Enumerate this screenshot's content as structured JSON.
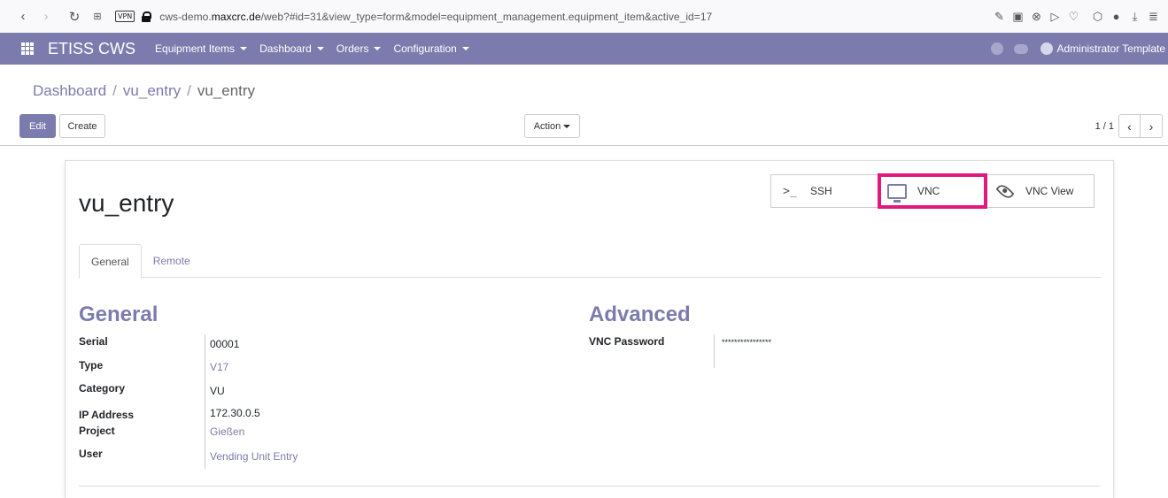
{
  "browser": {
    "vpn_badge": "VPN",
    "url_prefix": "cws-demo.",
    "url_domain": "maxcrc.de",
    "url_rest": "/web?#id=31&view_type=form&model=equipment_management.equipment_item&active_id=17"
  },
  "nav": {
    "brand": "ETISS CWS",
    "menu": [
      {
        "label": "Equipment Items"
      },
      {
        "label": "Dashboard"
      },
      {
        "label": "Orders"
      },
      {
        "label": "Configuration"
      }
    ],
    "user": "Administrator Template"
  },
  "breadcrumb": {
    "items": [
      "Dashboard",
      "vu_entry",
      "vu_entry"
    ],
    "separator": "/"
  },
  "control": {
    "edit_label": "Edit",
    "create_label": "Create",
    "action_label": "Action",
    "pager": "1 / 1"
  },
  "form": {
    "title": "vu_entry",
    "buttons": [
      {
        "label": "SSH",
        "icon": "terminal-icon"
      },
      {
        "label": "VNC",
        "icon": "monitor-icon"
      },
      {
        "label": "VNC View",
        "icon": "eye-icon"
      }
    ],
    "tabs": [
      {
        "label": "General",
        "active": true
      },
      {
        "label": "Remote",
        "active": false
      }
    ],
    "general": {
      "title": "General",
      "fields": {
        "serial": {
          "label": "Serial",
          "value": "00001"
        },
        "type": {
          "label": "Type",
          "value": "V17"
        },
        "category": {
          "label": "Category",
          "value": "VU"
        },
        "ip": {
          "label": "IP Address",
          "value": "172.30.0.5"
        },
        "project": {
          "label": "Project",
          "value": "Gießen"
        },
        "user": {
          "label": "User",
          "value": "Vending Unit Entry"
        }
      }
    },
    "advanced": {
      "title": "Advanced",
      "vnc_password": {
        "label": "VNC Password",
        "value": "****************"
      }
    }
  },
  "colors": {
    "brand": "#7c7bad",
    "highlight": "#e2187d"
  }
}
